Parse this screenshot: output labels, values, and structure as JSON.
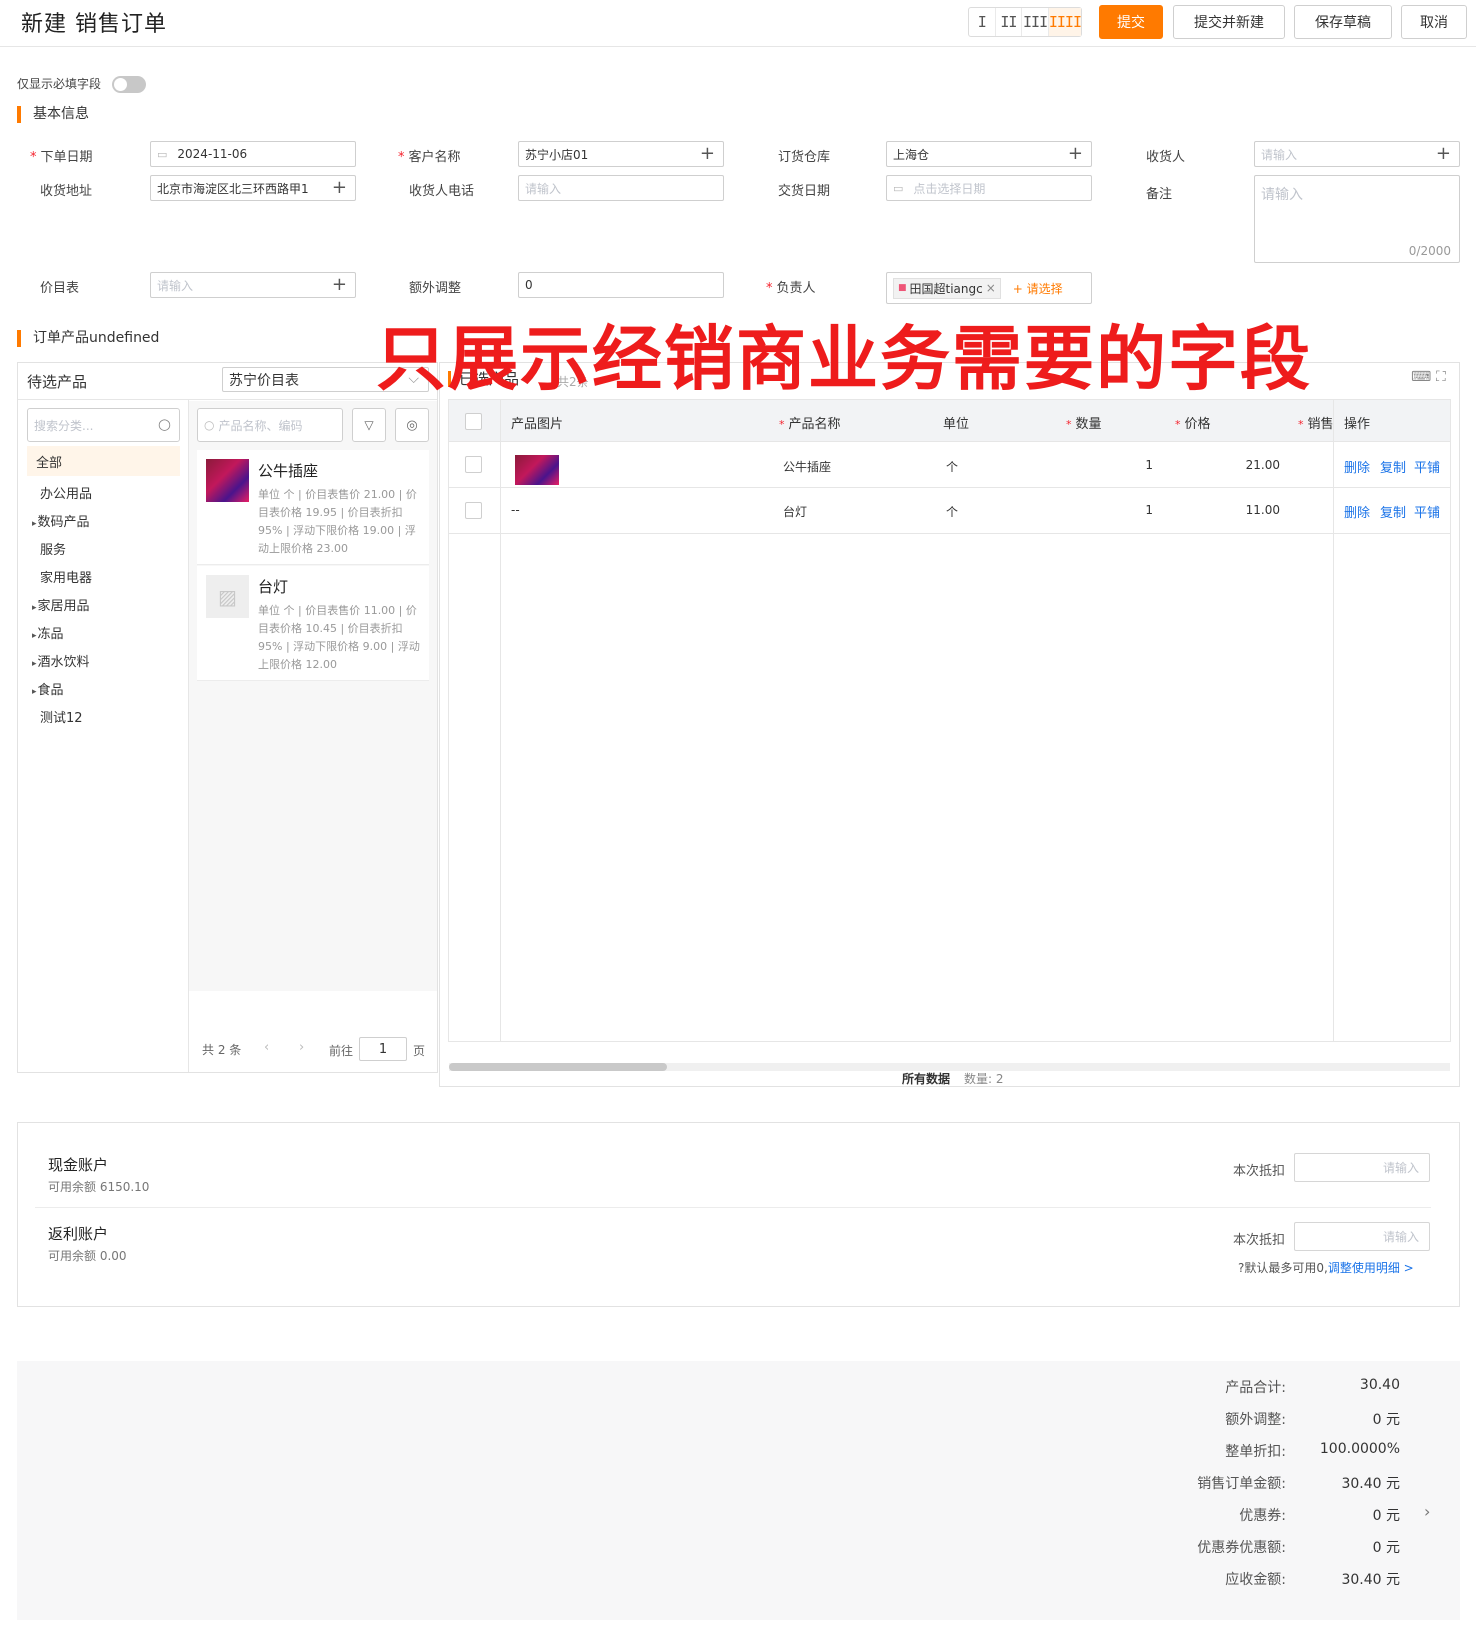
{
  "header": {
    "title": "新建 销售订单",
    "layout_options": [
      "I",
      "II",
      "III",
      "IIII"
    ],
    "buttons": {
      "submit": "提交",
      "submit_new": "提交并新建",
      "save_draft": "保存草稿",
      "cancel": "取消"
    }
  },
  "form": {
    "required_only": "仅显示必填字段",
    "section_basic": "基本信息",
    "order_date": {
      "label": "下单日期",
      "value": "2024-11-06"
    },
    "customer": {
      "label": "客户名称",
      "value": "苏宁小店01"
    },
    "warehouse": {
      "label": "订货仓库",
      "value": "上海仓"
    },
    "receiver": {
      "label": "收货人",
      "placeholder": "请输入"
    },
    "address": {
      "label": "收货地址",
      "value": "北京市海淀区北三环西路甲1"
    },
    "receiver_phone": {
      "label": "收货人电话",
      "placeholder": "请输入"
    },
    "delivery_date": {
      "label": "交货日期",
      "placeholder": "点击选择日期"
    },
    "remark": {
      "label": "备注",
      "placeholder": "请输入",
      "counter": "0/2000"
    },
    "price_list": {
      "label": "价目表",
      "placeholder": "请输入"
    },
    "extra_adjust": {
      "label": "额外调整",
      "value": "0"
    },
    "owner": {
      "label": "负责人",
      "tag": "田国超tiangc",
      "choose": "+ 请选择"
    }
  },
  "overlay_text": "只展示经销商业务需要的字段",
  "products": {
    "section_title": "订单产品undefined",
    "pending": {
      "title": "待选产品",
      "price_list": "苏宁价目表",
      "search_category": "搜索分类...",
      "search_product": "产品名称、编码",
      "categories": [
        "全部",
        "办公用品",
        "数码产品",
        "服务",
        "家用电器",
        "家居用品",
        "冻品",
        "酒水饮料",
        "食品",
        "测试12"
      ],
      "items": [
        {
          "name": "公牛插座",
          "desc": "单位 个 | 价目表售价 21.00 | 价目表价格 19.95 | 价目表折扣 95% | 浮动下限价格 19.00 | 浮动上限价格 23.00"
        },
        {
          "name": "台灯",
          "desc": "单位 个 | 价目表售价 11.00 | 价目表价格 10.45 | 价目表折扣 95% | 浮动下限价格 9.00 | 浮动上限价格 12.00"
        }
      ],
      "pagination": {
        "total": "共 2 条",
        "goto": "前往",
        "page": "1",
        "page_suffix": "页"
      }
    },
    "selected": {
      "title": "已选产品",
      "count": "共2条",
      "columns": [
        "产品图片",
        "产品名称",
        "单位",
        "数量",
        "价格",
        "销售",
        "操作"
      ],
      "rows": [
        {
          "image": "",
          "name": "公牛插座",
          "unit": "个",
          "qty": "1",
          "price": "21.00"
        },
        {
          "image": "--",
          "name": "台灯",
          "unit": "个",
          "qty": "1",
          "price": "11.00"
        }
      ],
      "actions": [
        "删除",
        "复制",
        "平铺"
      ],
      "footer_all": "所有数据",
      "footer_count": "数量: 2"
    }
  },
  "accounts": [
    {
      "name": "现金账户",
      "balance": "可用余额 6150.10",
      "deduct_label": "本次抵扣",
      "placeholder": "请输入"
    },
    {
      "name": "返利账户",
      "balance": "可用余额 0.00",
      "deduct_label": "本次抵扣",
      "placeholder": "请输入",
      "hint": "默认最多可用0,",
      "hint_link": "调整使用明细 >"
    }
  ],
  "summary": [
    {
      "label": "产品合计:",
      "value": "30.40"
    },
    {
      "label": "额外调整:",
      "value": "0 元"
    },
    {
      "label": "整单折扣:",
      "value": "100.0000%"
    },
    {
      "label": "销售订单金额:",
      "value": "30.40 元"
    },
    {
      "label": "优惠券:",
      "value": "0 元"
    },
    {
      "label": "优惠券优惠额:",
      "value": "0 元"
    },
    {
      "label": "应收金额:",
      "value": "30.40 元"
    }
  ],
  "colors": {
    "accent": "#ff7a00",
    "link": "#1a73e8",
    "overlay": "#ee1c1c"
  }
}
